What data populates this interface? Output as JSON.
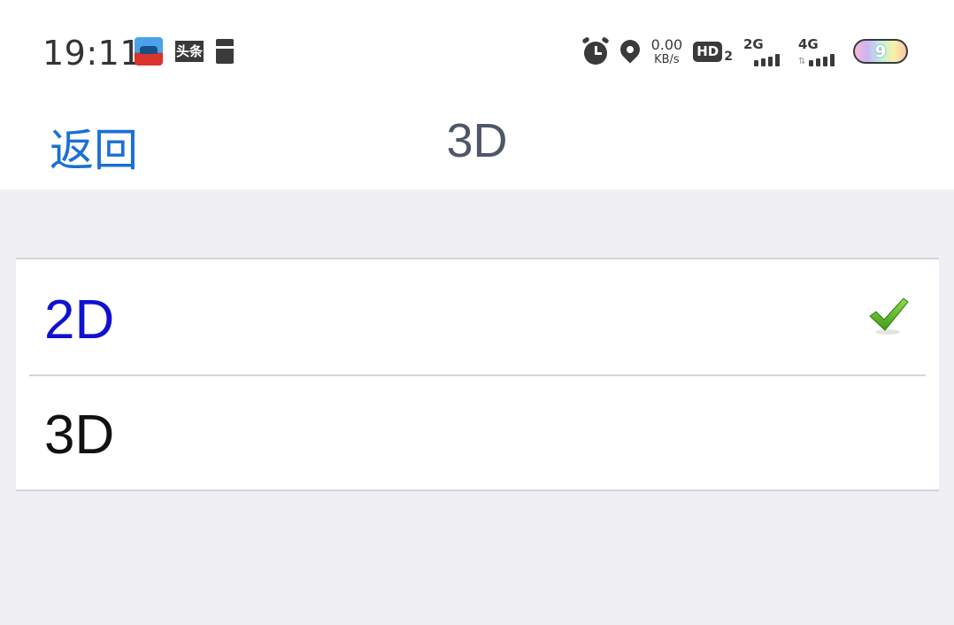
{
  "status_bar": {
    "time": "19:11",
    "notification_icons": [
      "car-app-icon",
      "toutiao-icon",
      "sd-card-icon"
    ],
    "toutiao_label": "头条",
    "net_speed_value": "0.00",
    "net_speed_unit": "KB/s",
    "hd_label": "HD",
    "hd_sub": "2",
    "signal_1_gen": "2G",
    "signal_2_gen": "4G",
    "battery_level": "9"
  },
  "nav": {
    "back_label": "返回",
    "title": "3D"
  },
  "options": [
    {
      "label": "2D",
      "selected": true
    },
    {
      "label": "3D",
      "selected": false
    }
  ],
  "colors": {
    "accent_blue": "#1a6fd4",
    "selected_text": "#1111d0",
    "title_text": "#4e5668",
    "check_green": "#4caf2a",
    "background": "#efeff4"
  }
}
